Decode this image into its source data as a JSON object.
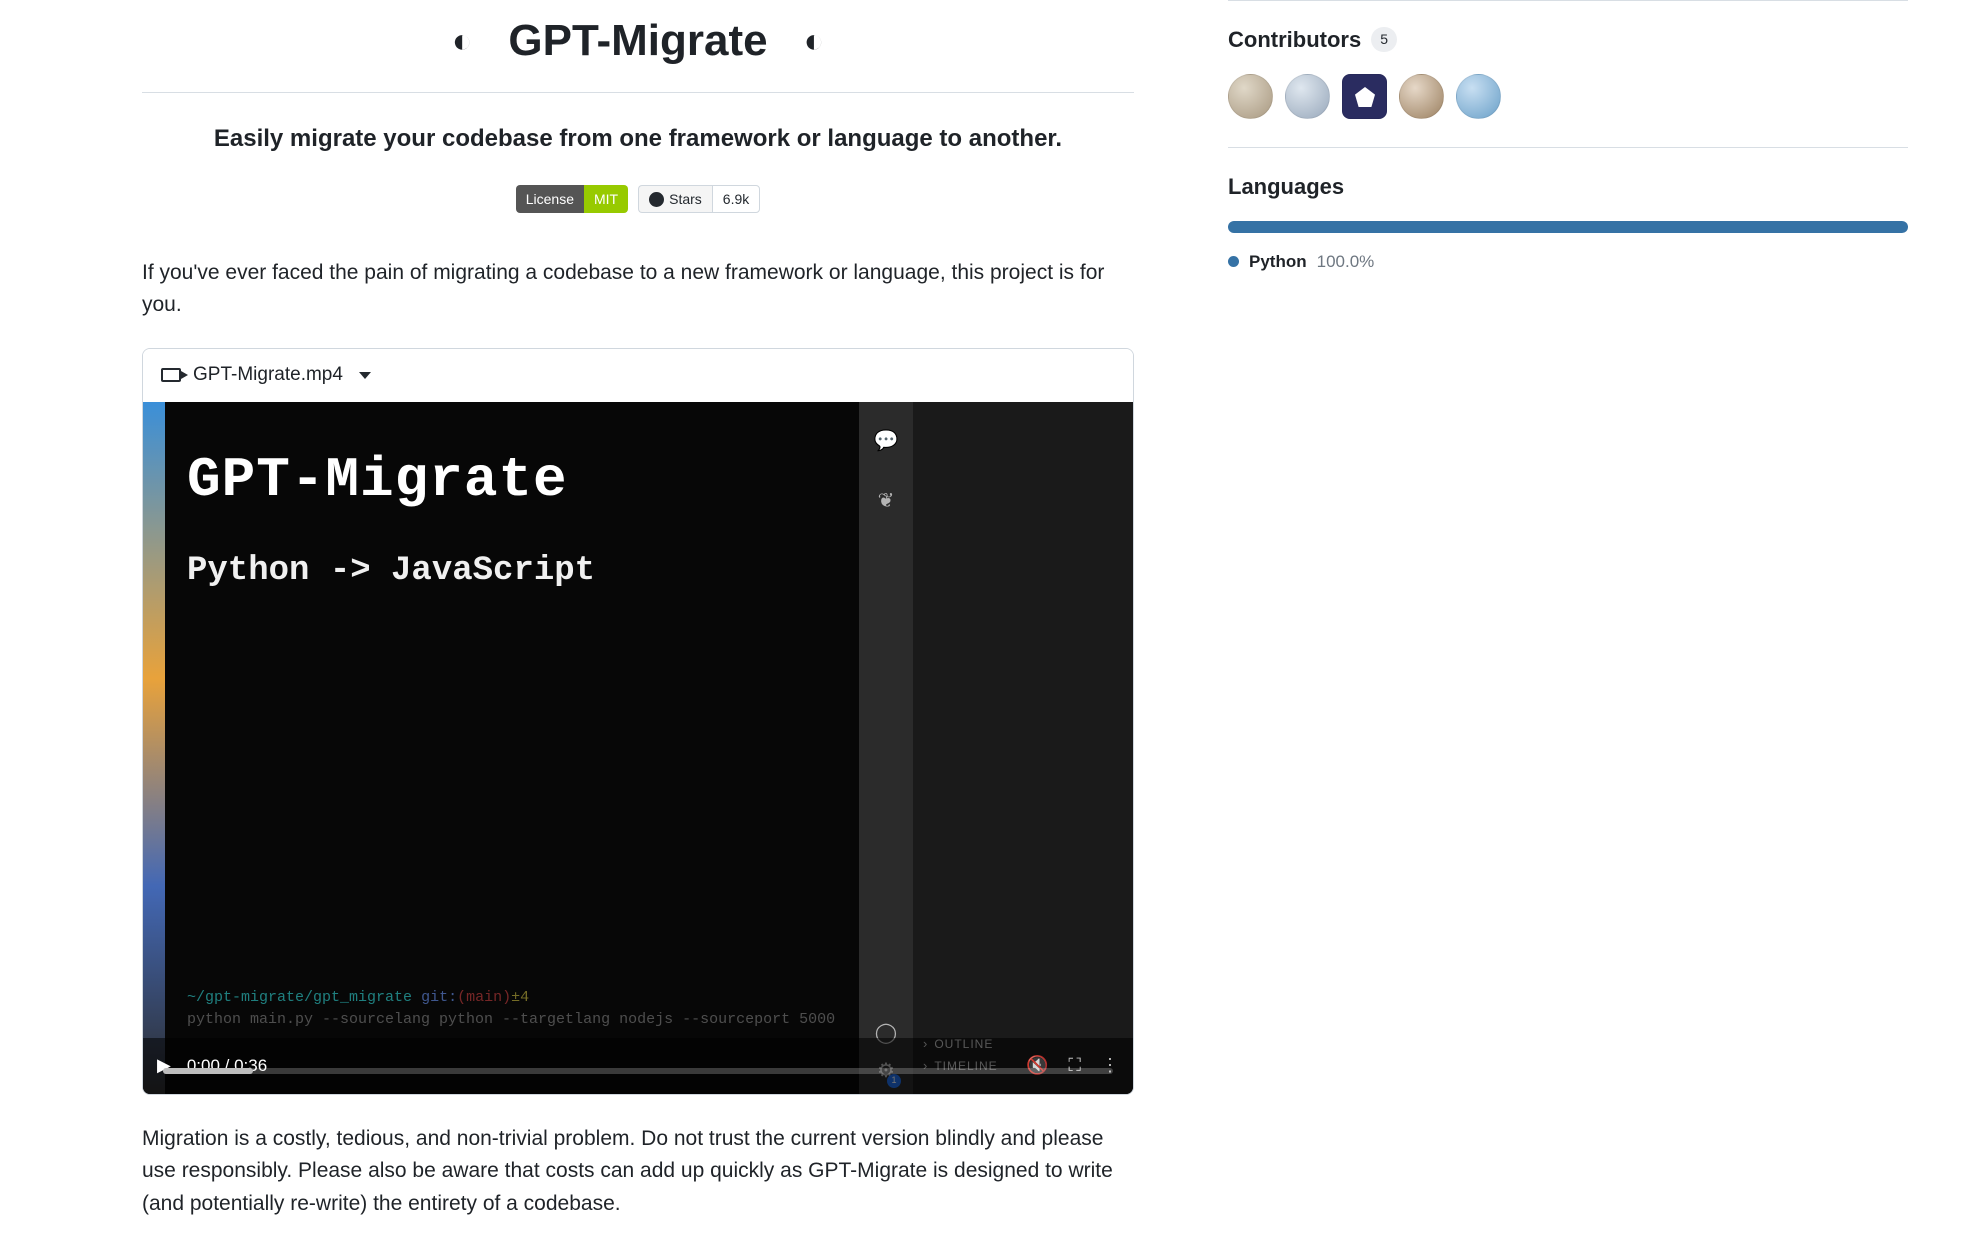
{
  "readme": {
    "title": "GPT-Migrate",
    "subtitle": "Easily migrate your codebase from one framework or language to another.",
    "badges": {
      "license_label": "License",
      "license_value": "MIT",
      "stars_label": "Stars",
      "stars_value": "6.9k"
    },
    "intro": "If you've ever faced the pain of migrating a codebase to a new framework or language, this project is for you.",
    "video": {
      "filename": "GPT-Migrate.mp4",
      "overlay_title": "GPT-Migrate",
      "overlay_subtitle": "Python -> JavaScript",
      "terminal_path": "~/gpt-migrate/gpt_migrate",
      "terminal_git": "git:",
      "terminal_branch": "(main)",
      "terminal_changes": "±4",
      "terminal_cmd": "python main.py --sourcelang python --targetlang nodejs --sourceport 5000",
      "time": "0:00 / 0:36",
      "side_outline": "OUTLINE",
      "side_timeline": "TIMELINE",
      "gear_badge": "1"
    },
    "paragraph": "Migration is a costly, tedious, and non-trivial problem. Do not trust the current version blindly and please use responsibly. Please also be aware that costs can add up quickly as GPT-Migrate is designed to write (and potentially re-write) the entirety of a codebase."
  },
  "sidebar": {
    "contributors_heading": "Contributors",
    "contributors_count": "5",
    "languages_heading": "Languages",
    "language_name": "Python",
    "language_pct": "100.0%"
  }
}
